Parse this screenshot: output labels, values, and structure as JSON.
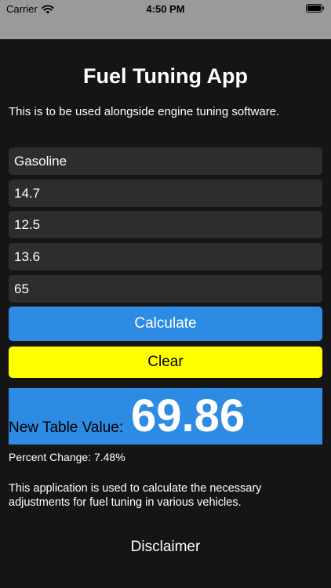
{
  "status_bar": {
    "carrier": "Carrier",
    "time": "4:50 PM",
    "icons": [
      "wifi-icon",
      "battery-icon"
    ]
  },
  "app": {
    "title": "Fuel Tuning App",
    "subtitle": "This is to be used alongside engine tuning software.",
    "fields": {
      "fuel_type": "Gasoline",
      "field_2": "14.7",
      "field_3": "12.5",
      "field_4": "13.6",
      "field_5": "65"
    },
    "buttons": {
      "calculate": "Calculate",
      "clear": "Clear",
      "disclaimer": "Disclaimer"
    },
    "result": {
      "label": "New Table Value:",
      "value": "69.86"
    },
    "percent_change": "Percent Change: 7.48%",
    "description": "This application is used to calculate the necessary adjustments for fuel tuning in various vehicles.",
    "colors": {
      "background": "#151515",
      "field": "#2d2d2d",
      "primary": "#2e8be4",
      "clear": "#ffff00",
      "status_bar": "#9a9a9a"
    }
  }
}
